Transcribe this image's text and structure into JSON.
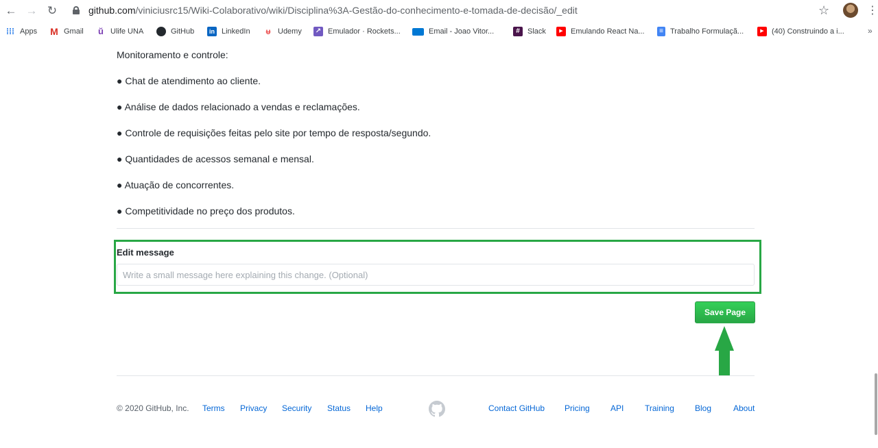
{
  "browser": {
    "url_host": "github.com",
    "url_path": "/viniciusrc15/Wiki-Colaborativo/wiki/Disciplina%3A-Gestão-do-conhecimento-e-tomada-de-decisão/_edit",
    "bookmarks": [
      {
        "label": "Apps",
        "icon": "apps-grid-icon"
      },
      {
        "label": "Gmail",
        "icon": "gmail-icon"
      },
      {
        "label": "Ulife UNA",
        "icon": "ulife-icon"
      },
      {
        "label": "GitHub",
        "icon": "github-icon"
      },
      {
        "label": "LinkedIn",
        "icon": "linkedin-icon"
      },
      {
        "label": "Udemy",
        "icon": "udemy-icon"
      },
      {
        "label": "Emulador · Rockets...",
        "icon": "rocketseat-icon"
      },
      {
        "label": "Email - Joao Vitor...",
        "icon": "email-icon"
      },
      {
        "label": "Slack",
        "icon": "slack-icon"
      },
      {
        "label": "Emulando React Na...",
        "icon": "youtube-icon"
      },
      {
        "label": "Trabalho Formulaçã...",
        "icon": "google-docs-icon"
      },
      {
        "label": "(40) Construindo a i...",
        "icon": "youtube-icon"
      }
    ],
    "more_label": "»"
  },
  "page": {
    "section_title": "Monitoramento e controle:",
    "bullets": [
      "● Chat de atendimento ao cliente.",
      "● Análise de dados relacionado a vendas e reclamações.",
      "● Controle de requisições feitas pelo site por tempo de resposta/segundo.",
      "● Quantidades de acessos semanal e mensal.",
      "● Atuação de concorrentes.",
      "● Competitividade no preço dos produtos."
    ],
    "edit_message": {
      "label": "Edit message",
      "value": "",
      "placeholder": "Write a small message here explaining this change. (Optional)"
    },
    "save_button": "Save Page",
    "highlight_color": "#28a745"
  },
  "footer": {
    "copyright": "© 2020 GitHub, Inc.",
    "left_links": [
      "Terms",
      "Privacy",
      "Security",
      "Status",
      "Help"
    ],
    "right_links": [
      "Contact GitHub",
      "Pricing",
      "API",
      "Training",
      "Blog",
      "About"
    ]
  }
}
